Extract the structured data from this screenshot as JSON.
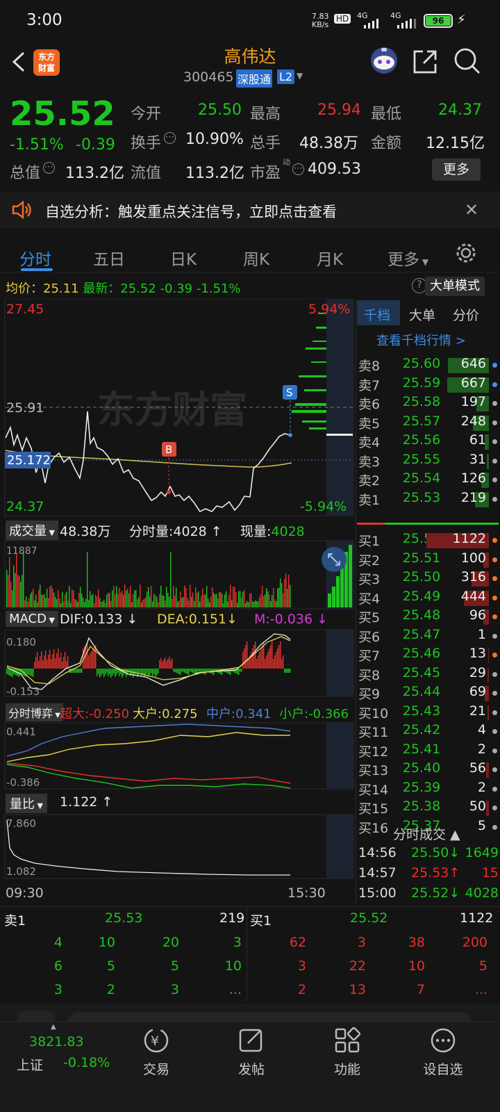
{
  "status_bar": {
    "time": "3:00",
    "net_speed": "7.83",
    "net_unit": "KB/s",
    "hd": "HD",
    "sig1": "4G",
    "sig2": "4G",
    "battery": "96"
  },
  "header": {
    "logo_text": "东方\n财富",
    "stock_name": "高伟达",
    "stock_code": "300465",
    "tag_connect": "深股通",
    "tag_level": "L2"
  },
  "quote": {
    "price": "25.52",
    "change_pct": "-1.51%",
    "change": "-0.39",
    "open_label": "今开",
    "open": "25.50",
    "high_label": "最高",
    "high": "25.94",
    "low_label": "最低",
    "low": "24.37",
    "turnover_label": "换手",
    "turnover": "10.90%",
    "volume_label": "总手",
    "volume": "48.38万",
    "amount_label": "金额",
    "amount": "12.15亿",
    "mktcap_label": "总值",
    "mktcap": "113.2亿",
    "float_label": "流值",
    "float": "113.2亿",
    "pe_label": "市盈",
    "pe_sup": "动",
    "pe": "409.53",
    "more_button": "更多"
  },
  "banner": {
    "text": "自选分析：触发重点关注信号，立即点击查看"
  },
  "tabs": [
    "分时",
    "五日",
    "日K",
    "周K",
    "月K",
    "更多"
  ],
  "avg_line": {
    "avg_label": "均价：",
    "avg": "25.11",
    "latest_label": "最新：",
    "latest": "25.52",
    "chg": "-0.39",
    "chg_pct": "-1.51%",
    "mode_button": "大单模式"
  },
  "price_chart": {
    "top_price": "27.45",
    "top_pct": "5.94%",
    "bottom_price": "24.37",
    "bottom_pct": "-5.94%",
    "ref_price": "25.91",
    "cur_tag": "25.172",
    "mark_b": "B",
    "mark_s": "S",
    "watermark": "东方财富"
  },
  "volume_panel": {
    "select": "成交量",
    "total": "48.38万",
    "tick_label": "分时量:",
    "tick": "4028",
    "now_label": "现量:",
    "now": "4028",
    "max": "11887"
  },
  "macd_panel": {
    "select": "MACD",
    "dif": "DIF:0.133",
    "dea": "DEA:0.151",
    "m": "M:-0.036",
    "top": "0.180",
    "bottom": "-0.153"
  },
  "fund_panel": {
    "select": "分时博弈",
    "super": "超大:-0.250",
    "big": "大户:0.275",
    "mid": "中户:0.341",
    "small": "小户:-0.366",
    "top": "0.441",
    "bottom": "-0.386"
  },
  "ratio_panel": {
    "select": "量比",
    "value": "1.122",
    "top": "7.860",
    "bottom": "1.082"
  },
  "time_axis": {
    "start": "09:30",
    "end": "15:30"
  },
  "sidebar": {
    "tabs": [
      "千档",
      "大单",
      "分价"
    ],
    "link": "查看千档行情 >",
    "asks": [
      {
        "label": "卖8",
        "price": "25.60",
        "vol": "646",
        "dot": "#4a90e2"
      },
      {
        "label": "卖7",
        "price": "25.59",
        "vol": "667",
        "dot": "#4a90e2"
      },
      {
        "label": "卖6",
        "price": "25.58",
        "vol": "197",
        "dot": "#aaaaaa"
      },
      {
        "label": "卖5",
        "price": "25.57",
        "vol": "248",
        "dot": "#aaaaaa"
      },
      {
        "label": "卖4",
        "price": "25.56",
        "vol": "61",
        "dot": "#aaaaaa"
      },
      {
        "label": "卖3",
        "price": "25.55",
        "vol": "31",
        "dot": "#aaaaaa"
      },
      {
        "label": "卖2",
        "price": "25.54",
        "vol": "126",
        "dot": "#aaaaaa"
      },
      {
        "label": "卖1",
        "price": "25.53",
        "vol": "219",
        "dot": "#aaaaaa"
      }
    ],
    "bids": [
      {
        "label": "买1",
        "price": "25.52",
        "vol": "1122",
        "dot": "#f07a2a"
      },
      {
        "label": "买2",
        "price": "25.51",
        "vol": "100",
        "dot": "#f07a2a"
      },
      {
        "label": "买3",
        "price": "25.50",
        "vol": "316",
        "dot": "#f07a2a"
      },
      {
        "label": "买4",
        "price": "25.49",
        "vol": "444",
        "dot": "#f07a2a"
      },
      {
        "label": "买5",
        "price": "25.48",
        "vol": "96",
        "dot": "#f07a2a"
      },
      {
        "label": "买6",
        "price": "25.47",
        "vol": "1",
        "dot": "#aaaaaa"
      },
      {
        "label": "买7",
        "price": "25.46",
        "vol": "13",
        "dot": "#f07a2a"
      },
      {
        "label": "买8",
        "price": "25.45",
        "vol": "29",
        "dot": "#aaaaaa"
      },
      {
        "label": "买9",
        "price": "25.44",
        "vol": "69",
        "dot": "#aaaaaa"
      },
      {
        "label": "买10",
        "price": "25.43",
        "vol": "21",
        "dot": "#aaaaaa"
      },
      {
        "label": "买11",
        "price": "25.42",
        "vol": "4",
        "dot": "#aaaaaa"
      },
      {
        "label": "买12",
        "price": "25.41",
        "vol": "2",
        "dot": "#aaaaaa"
      },
      {
        "label": "买13",
        "price": "25.40",
        "vol": "56",
        "dot": "#aaaaaa"
      },
      {
        "label": "买14",
        "price": "25.39",
        "vol": "2",
        "dot": "#aaaaaa"
      },
      {
        "label": "买15",
        "price": "25.38",
        "vol": "50",
        "dot": "#aaaaaa"
      },
      {
        "label": "买16",
        "price": "25.37",
        "vol": "5",
        "dot": "#aaaaaa"
      }
    ],
    "trades_title": "分时成交",
    "trades": [
      {
        "time": "14:56",
        "price": "25.50↓",
        "vol": "1649",
        "color": "#1fc51f"
      },
      {
        "time": "14:57",
        "price": "25.53↑",
        "vol": "15",
        "color": "#e6322e"
      },
      {
        "time": "15:00",
        "price": "25.52↓",
        "vol": "4028",
        "color": "#1fc51f"
      }
    ]
  },
  "book_bottom": {
    "sell_label": "卖1",
    "sell_price": "25.53",
    "sell_vol": "219",
    "buy_label": "买1",
    "buy_price": "25.52",
    "buy_vol": "1122",
    "sell_rows": [
      [
        "4",
        "10",
        "20",
        "3"
      ],
      [
        "6",
        "5",
        "5",
        "10"
      ],
      [
        "3",
        "2",
        "3",
        "..."
      ]
    ],
    "buy_rows": [
      [
        "62",
        "3",
        "38",
        "200"
      ],
      [
        "3",
        "22",
        "10",
        "5"
      ],
      [
        "2",
        "13",
        "7",
        "..."
      ]
    ]
  },
  "bottom_nav": {
    "index_value": "3821.83",
    "index_name": "上证",
    "index_chg": "-0.18%",
    "items": [
      "交易",
      "发帖",
      "功能",
      "设自选"
    ]
  },
  "colors": {
    "up": "#e6322e",
    "down": "#1fc51f",
    "accent": "#f0a020",
    "blue": "#4a90e2"
  }
}
